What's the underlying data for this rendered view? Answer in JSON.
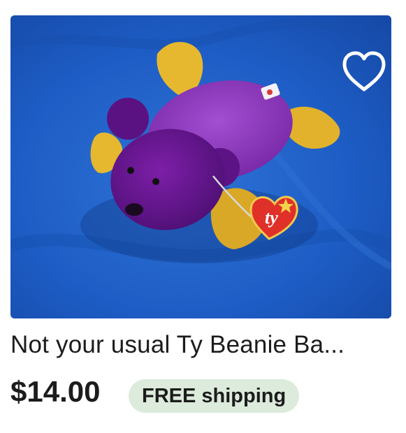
{
  "listing": {
    "title": "Not your usual Ty Beanie Ba...",
    "price": "$14.00",
    "shipping_badge": "FREE shipping",
    "tag_text": "ty"
  },
  "icons": {
    "favorite": "heart-outline-icon"
  },
  "colors": {
    "badge_background": "#dcebdc",
    "text": "#1c1c1c",
    "photo_blanket": "#1f5fbf",
    "bear_purple": "#6f1a9a",
    "bear_body": "#8f3cc2",
    "bear_paws": "#e6b830",
    "tag_red": "#e0302a"
  }
}
